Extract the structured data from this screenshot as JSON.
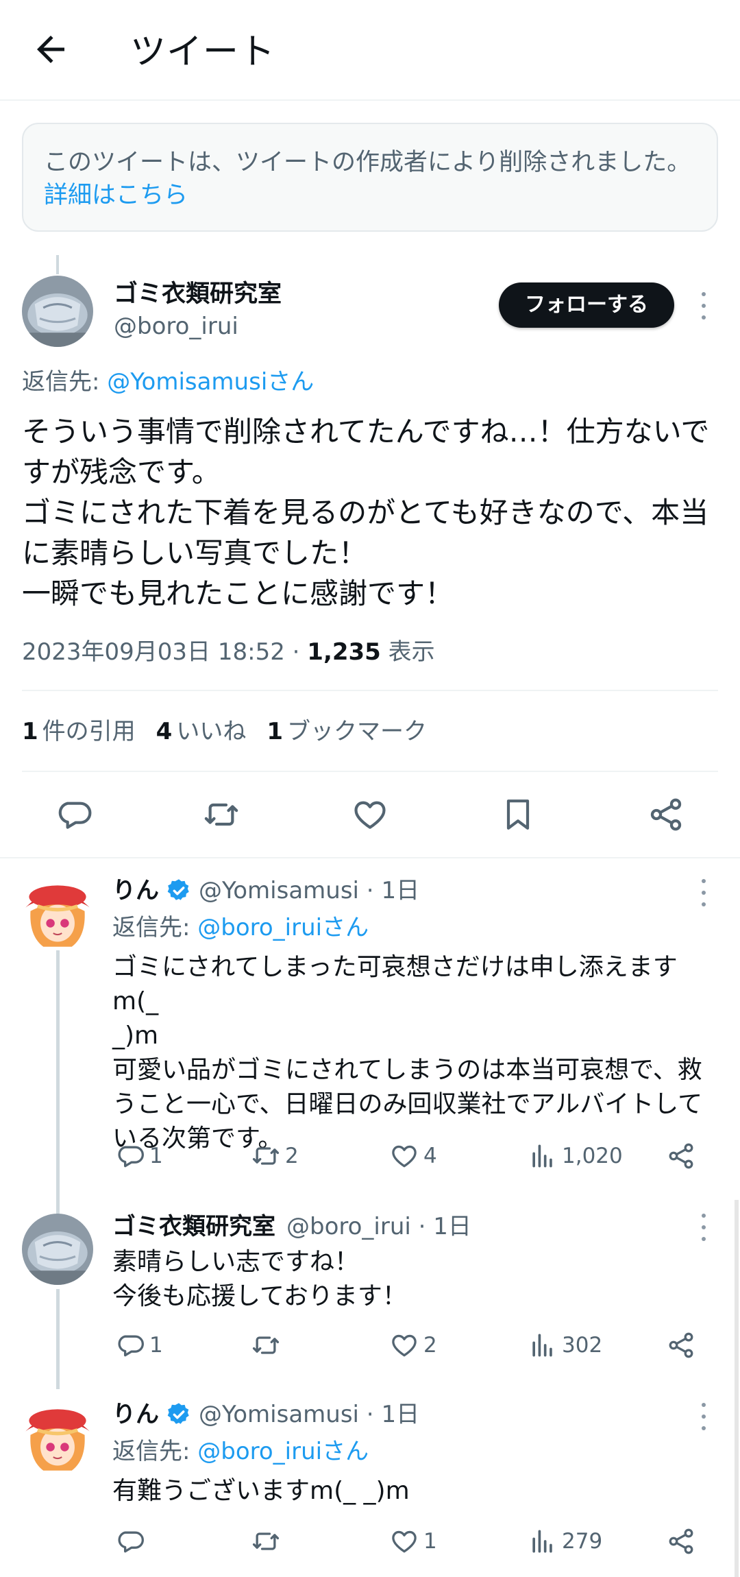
{
  "header": {
    "title": "ツイート",
    "back_icon": "arrow-left-icon"
  },
  "deleted_notice": {
    "text": "このツイートは、ツイートの作成者により削除されました。",
    "link": "詳細はこちら"
  },
  "main_tweet": {
    "author_name": "ゴミ衣類研究室",
    "author_handle": "@boro_irui",
    "follow_label": "フォローする",
    "reply_to_prefix": "返信先: ",
    "reply_to_handle": "@Yomisamusiさん",
    "text": "そういう事情で削除されてたんですね…！仕方ないですが残念です。\nゴミにされた下着を見るのがとても好きなので、本当に素晴らしい写真でした！\n一瞬でも見れたことに感謝です！",
    "timestamp": "2023年09月03日 18:52",
    "separator": " · ",
    "views": "1,235",
    "views_label": " 表示",
    "quotes_count": "1",
    "quotes_label": "件の引用",
    "likes_count": "4",
    "likes_label": "いいね",
    "bookmarks_count": "1",
    "bookmarks_label": "ブックマーク"
  },
  "replies": [
    {
      "name": "りん",
      "verified": true,
      "handle": "@Yomisamusi",
      "time": "1日",
      "reply_to_prefix": "返信先: ",
      "reply_to_handle": "@boro_iruiさん",
      "text": "ゴミにされてしまった可哀想さだけは申し添えますm(_\n_)m\n可愛い品がゴミにされてしまうのは本当可哀想で、救うこと一心で、日曜日のみ回収業社でアルバイトしている次第です。",
      "replies": "1",
      "retweets": "2",
      "likes": "4",
      "views": "1,020"
    },
    {
      "name": "ゴミ衣類研究室",
      "verified": false,
      "handle": "@boro_irui",
      "time": "1日",
      "text": "素晴らしい志ですね！\n今後も応援しております！",
      "replies": "1",
      "retweets": "",
      "likes": "2",
      "views": "302"
    },
    {
      "name": "りん",
      "verified": true,
      "handle": "@Yomisamusi",
      "time": "1日",
      "reply_to_prefix": "返信先: ",
      "reply_to_handle": "@boro_iruiさん",
      "text": "有難うございますm(_ _)m",
      "replies": "",
      "retweets": "",
      "likes": "1",
      "views": "279"
    }
  ],
  "colors": {
    "accent": "#1d9bf0",
    "text": "#0f1419",
    "secondary": "#536471",
    "verified": "#1d9bf0"
  }
}
